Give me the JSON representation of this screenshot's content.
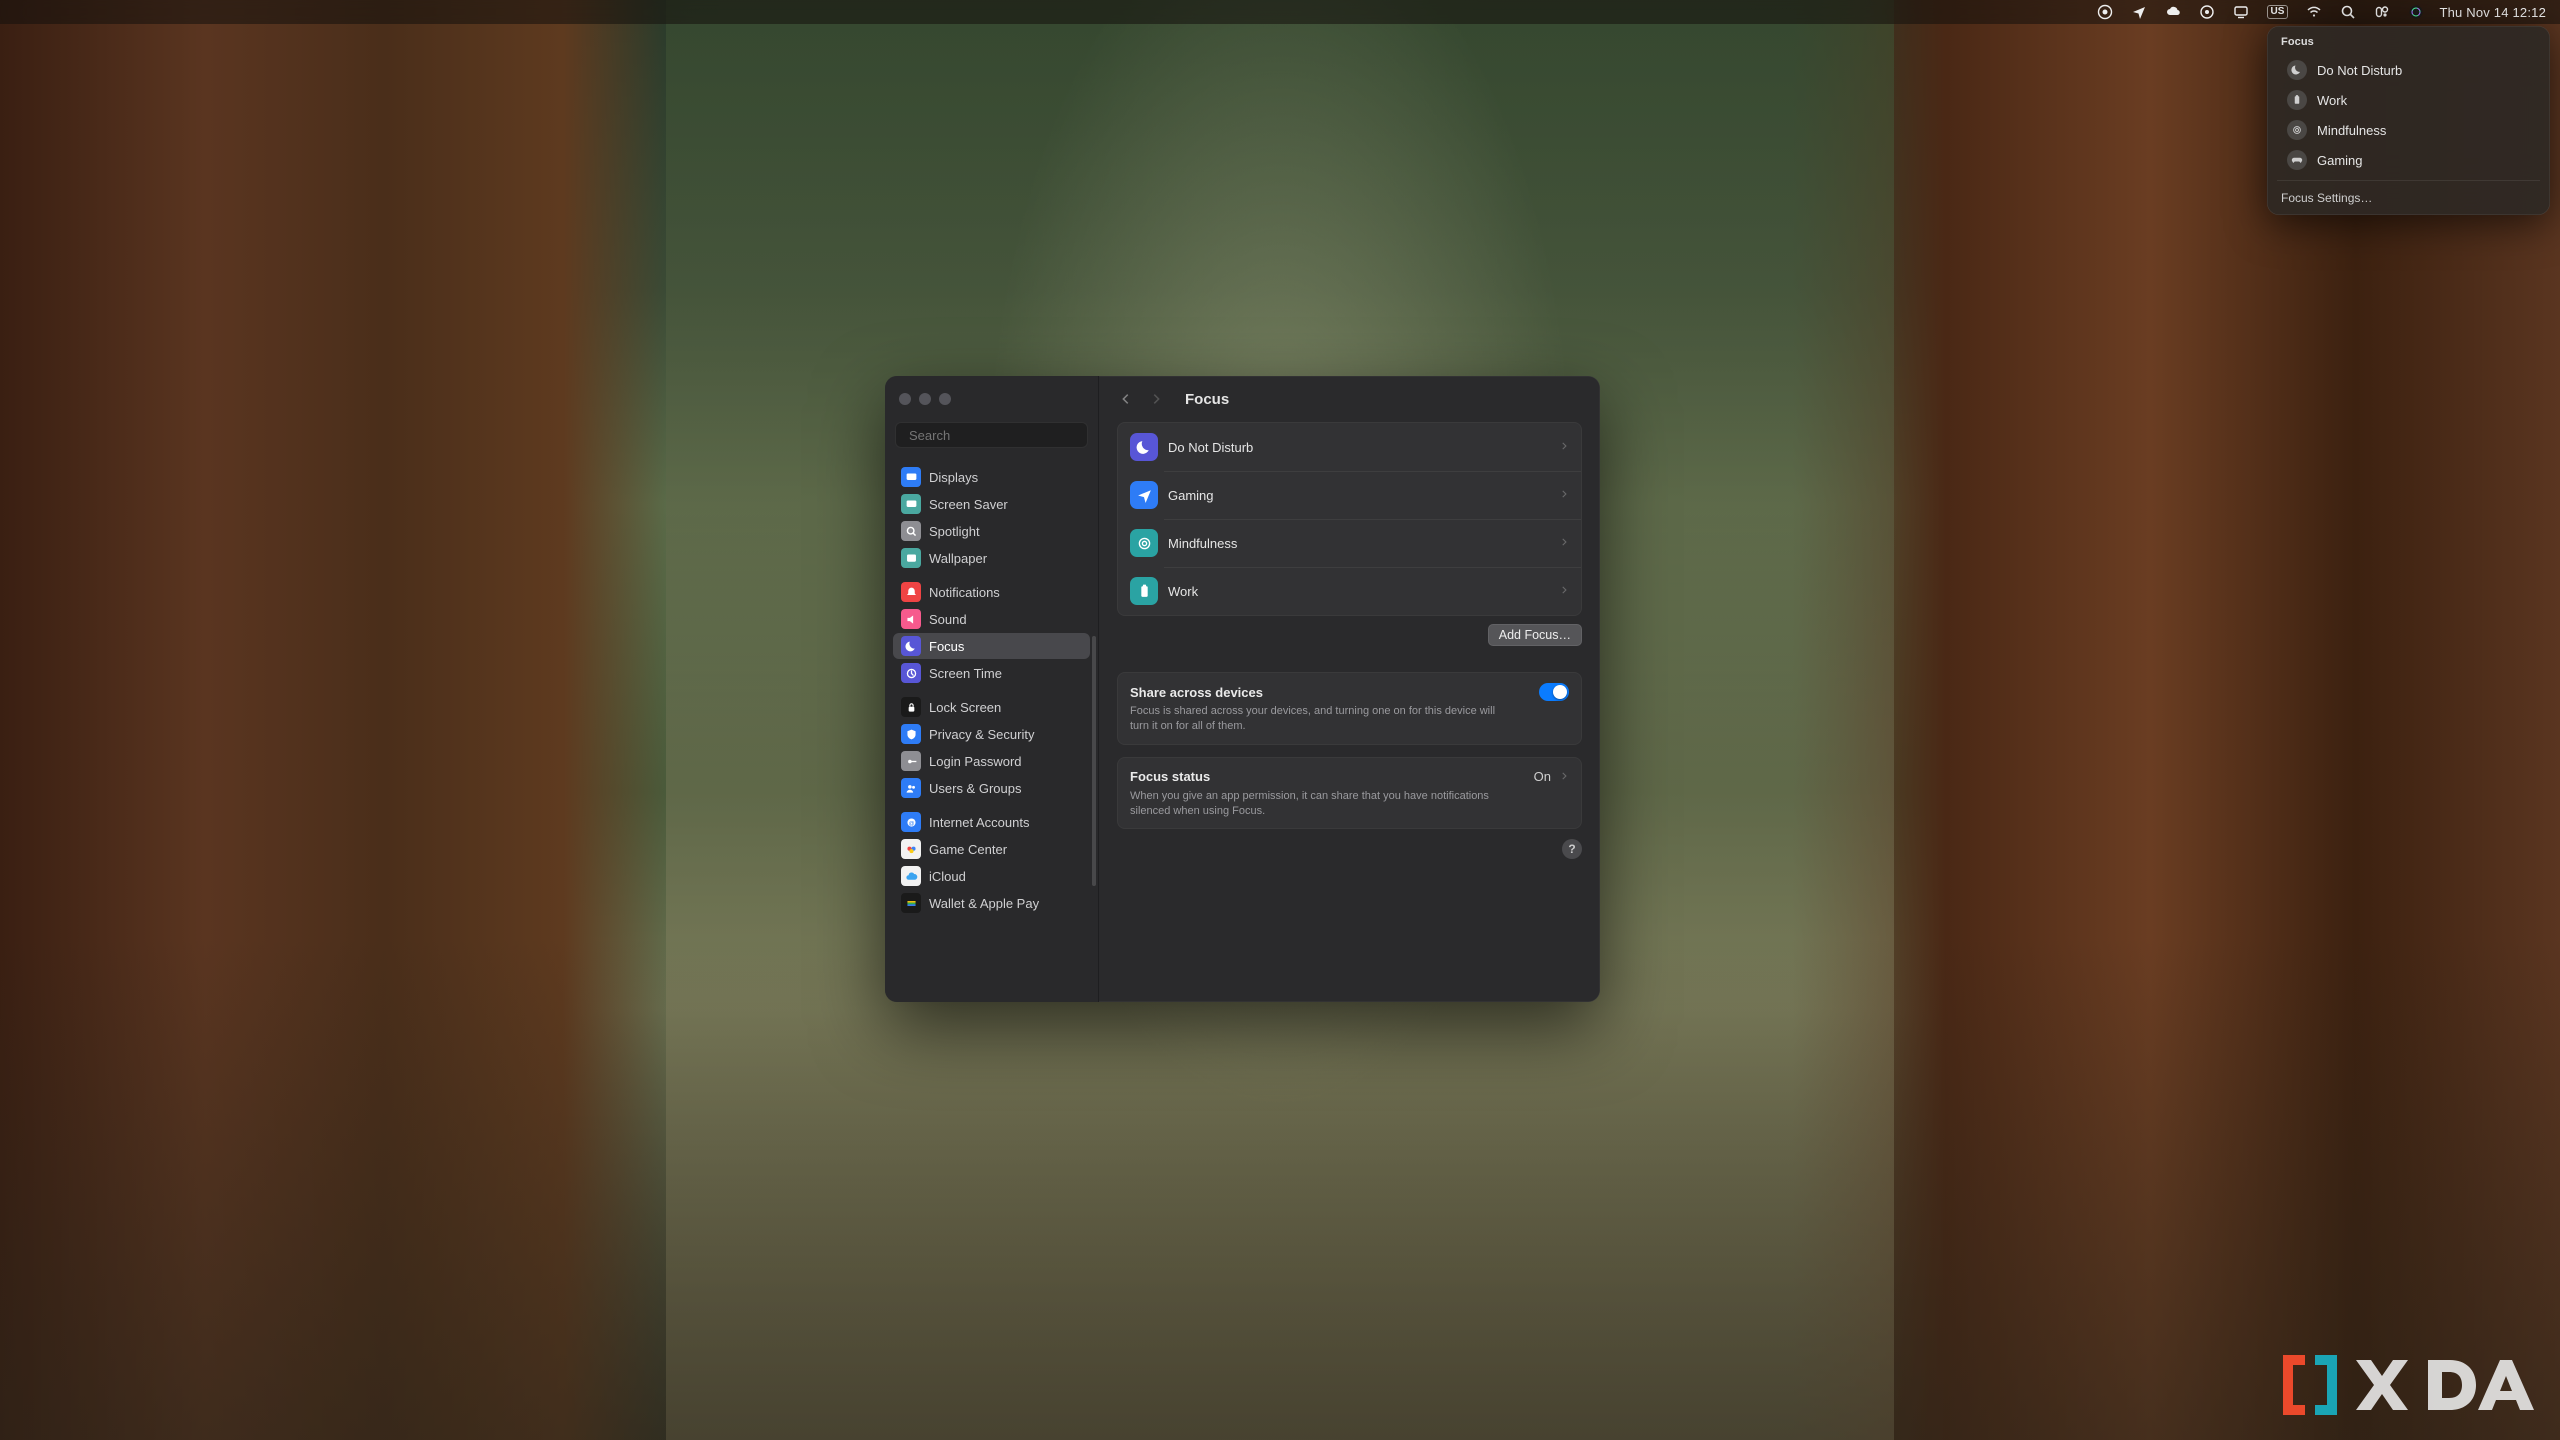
{
  "menubar": {
    "datetime": "Thu Nov 14  12:12",
    "keyboard_indicator": "US"
  },
  "focus_popover": {
    "title": "Focus",
    "items": [
      {
        "label": "Do Not Disturb"
      },
      {
        "label": "Work"
      },
      {
        "label": "Mindfulness"
      },
      {
        "label": "Gaming"
      }
    ],
    "settings_label": "Focus Settings…"
  },
  "window": {
    "search_placeholder": "Search",
    "header_title": "Focus",
    "sidebar_groups": [
      [
        {
          "label": "Displays"
        },
        {
          "label": "Screen Saver"
        },
        {
          "label": "Spotlight"
        },
        {
          "label": "Wallpaper"
        }
      ],
      [
        {
          "label": "Notifications"
        },
        {
          "label": "Sound"
        },
        {
          "label": "Focus"
        },
        {
          "label": "Screen Time"
        }
      ],
      [
        {
          "label": "Lock Screen"
        },
        {
          "label": "Privacy & Security"
        },
        {
          "label": "Login Password"
        },
        {
          "label": "Users & Groups"
        }
      ],
      [
        {
          "label": "Internet Accounts"
        },
        {
          "label": "Game Center"
        },
        {
          "label": "iCloud"
        },
        {
          "label": "Wallet & Apple Pay"
        }
      ]
    ],
    "focus_list": [
      {
        "label": "Do Not Disturb"
      },
      {
        "label": "Gaming"
      },
      {
        "label": "Mindfulness"
      },
      {
        "label": "Work"
      }
    ],
    "add_focus_label": "Add Focus…",
    "share": {
      "title": "Share across devices",
      "desc": "Focus is shared across your devices, and turning one on for this device will turn it on for all of them."
    },
    "status": {
      "title": "Focus status",
      "value": "On",
      "desc": "When you give an app permission, it can share that you have notifications silenced when using Focus."
    },
    "help_label": "?"
  },
  "watermark": {
    "text": "XDA"
  }
}
